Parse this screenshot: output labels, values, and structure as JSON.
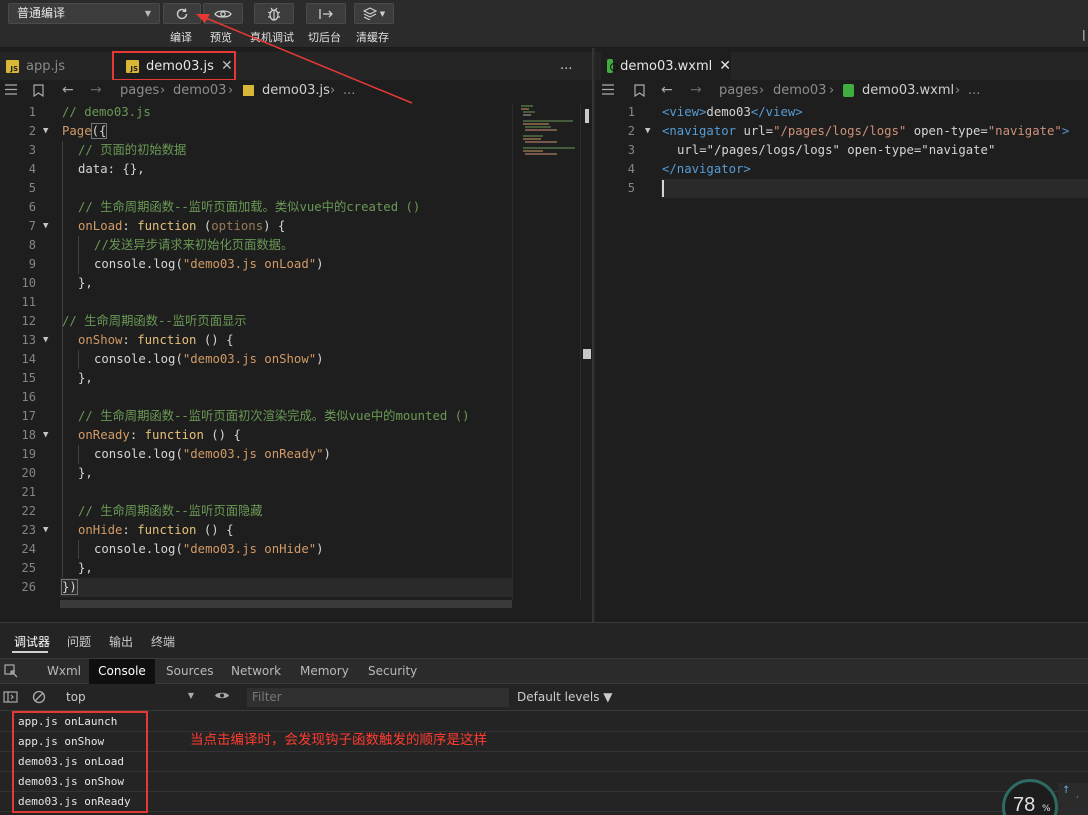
{
  "toolbar": {
    "compile_mode": "普通编译",
    "buttons": [
      "编译",
      "预览",
      "真机调试",
      "切后台",
      "清缓存"
    ]
  },
  "left_editor": {
    "tabs": [
      {
        "label": "app.js",
        "active": false
      },
      {
        "label": "demo03.js",
        "active": true
      }
    ],
    "more": "...",
    "breadcrumb": [
      "pages",
      "demo03",
      "demo03.js",
      "..."
    ]
  },
  "right_editor": {
    "tab": {
      "label": "demo03.wxml"
    },
    "breadcrumb": [
      "pages",
      "demo03",
      "demo03.wxml",
      "..."
    ]
  },
  "js_lines": [
    "1",
    "2",
    "3",
    "4",
    "5",
    "6",
    "7",
    "8",
    "9",
    "10",
    "11",
    "12",
    "13",
    "14",
    "15",
    "16",
    "17",
    "18",
    "19",
    "20",
    "21",
    "22",
    "23",
    "24",
    "25",
    "26"
  ],
  "js_code": {
    "l1": "// demo03.js",
    "l2a": "Page",
    "l2b": "({",
    "l3": "// 页面的初始数据",
    "l4a": "data",
    "l4b": ": {},",
    "l6": "// 生命周期函数--监听页面加载。类似vue中的created ()",
    "l7a": "onLoad",
    "l7b": ": ",
    "l7c": "function",
    "l7d": " (",
    "l7e": "options",
    "l7f": ") {",
    "l8": "//发送异步请求来初始化页面数据。",
    "l9a": "console",
    "l9b": ".log(",
    "l9c": "\"demo03.js onLoad\"",
    "l9d": ")",
    "l10": "},",
    "l12": "// 生命周期函数--监听页面显示",
    "l13a": "onShow",
    "l13b": ": ",
    "l13c": "function",
    "l13d": " () {",
    "l14a": "console",
    "l14b": ".log(",
    "l14c": "\"demo03.js onShow\"",
    "l14d": ")",
    "l15": "},",
    "l17": "// 生命周期函数--监听页面初次渲染完成。类似vue中的mounted ()",
    "l18a": "onReady",
    "l18b": ": ",
    "l18c": "function",
    "l18d": " () {",
    "l19a": "console",
    "l19b": ".log(",
    "l19c": "\"demo03.js onReady\"",
    "l19d": ")",
    "l20": "},",
    "l22": "// 生命周期函数--监听页面隐藏",
    "l23a": "onHide",
    "l23b": ": ",
    "l23c": "function",
    "l23d": " () {",
    "l24a": "console",
    "l24b": ".log(",
    "l24c": "\"demo03.js onHide\"",
    "l24d": ")",
    "l25": "},",
    "l26": "})"
  },
  "wxml_lines": [
    "1",
    "2",
    "3",
    "4",
    "5"
  ],
  "wxml_code": {
    "l1a": "<view>",
    "l1b": "demo03",
    "l1c": "</view>",
    "l2a": "<navigator",
    "l2b": " url=",
    "l2c": "\"/pages/logs/logs\"",
    "l2d": " open-type=",
    "l2e": "\"navigate\"",
    "l2f": ">",
    "l3": "url=\"/pages/logs/logs\" open-type=\"navigate\"",
    "l4": "</navigator>"
  },
  "debugger": {
    "tabs": [
      "调试器",
      "问题",
      "输出",
      "终端"
    ],
    "devtools_tabs": [
      "Wxml",
      "Console",
      "Sources",
      "Network",
      "Memory",
      "Security"
    ],
    "active_devtools_tab": "Console",
    "context": "top",
    "filter_placeholder": "Filter",
    "levels": "Default levels ▼",
    "console_lines": [
      "app.js onLaunch",
      "app.js onShow",
      "demo03.js onLoad",
      "demo03.js onShow",
      "demo03.js onReady"
    ]
  },
  "annotation": "当点击编译时，会发现钩子函数触发的顺序是这样",
  "performance_badge": {
    "value": "78",
    "unit": "%"
  },
  "colors": {
    "highlight_red": "#e53935",
    "annotation_red": "#ff3b30",
    "accent_green": "#3fae3f"
  }
}
